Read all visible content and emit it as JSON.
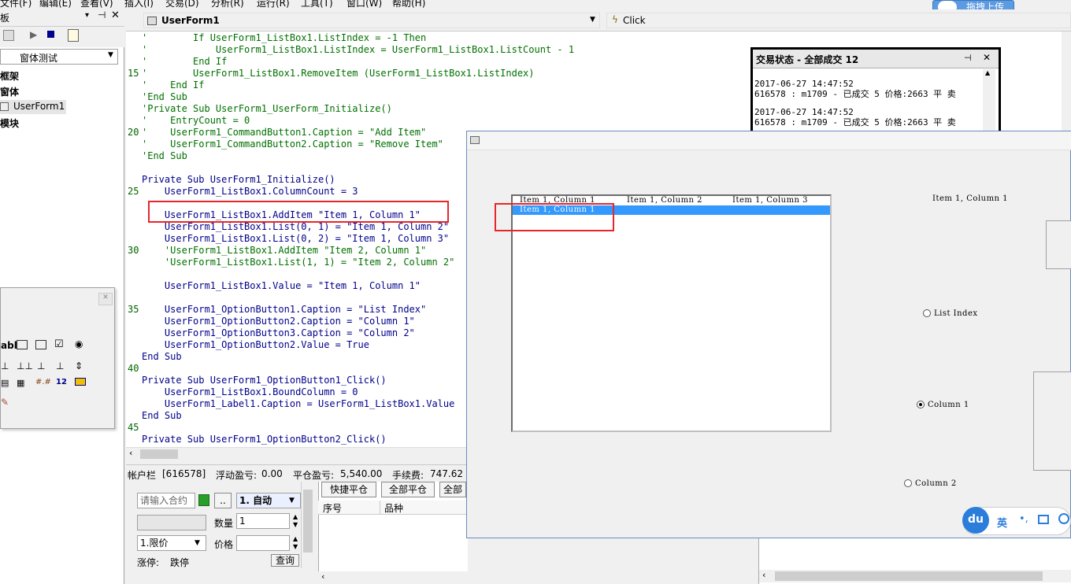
{
  "menubar": {
    "items": [
      "文件(F)",
      "编辑(E)",
      "查看(V)",
      "插入(I)",
      "交易(D)",
      "分析(R)",
      "运行(R)",
      "工具(T)",
      "窗口(W)",
      "帮助(H)"
    ],
    "upload_label": "拖拽上传"
  },
  "left_panel": {
    "title": "板",
    "combo_value": "窗体测试",
    "tree": [
      {
        "label": "框架"
      },
      {
        "label": "窗体"
      },
      {
        "label": "UserForm1"
      },
      {
        "label": "模块"
      }
    ]
  },
  "code_window": {
    "object_combo": "UserForm1",
    "procedure_combo": "Click",
    "line_numbers": [
      "15",
      "20",
      "25",
      "30",
      "35",
      "40",
      "45"
    ],
    "lines": [
      "'        If UserForm1_ListBox1.ListIndex = -1 Then",
      "'            UserForm1_ListBox1.ListIndex = UserForm1_ListBox1.ListCount - 1",
      "'        End If",
      "'        UserForm1_ListBox1.RemoveItem (UserForm1_ListBox1.ListIndex)",
      "'    End If",
      "'End Sub",
      "'Private Sub UserForm1_UserForm_Initialize()",
      "'    EntryCount = 0",
      "'    UserForm1_CommandButton1.Caption = \"Add Item\"",
      "'    UserForm1_CommandButton2.Caption = \"Remove Item\"",
      "'End Sub",
      "",
      "Private Sub UserForm1_Initialize()",
      "    UserForm1_ListBox1.ColumnCount = 3",
      "",
      "    UserForm1_ListBox1.AddItem \"Item 1, Column 1\"",
      "    UserForm1_ListBox1.List(0, 1) = \"Item 1, Column 2\"",
      "    UserForm1_ListBox1.List(0, 2) = \"Item 1, Column 3\"",
      "    'UserForm1_ListBox1.AddItem \"Item 2, Column 1\"",
      "    'UserForm1_ListBox1.List(1, 1) = \"Item 2, Column 2\"",
      "",
      "    UserForm1_ListBox1.Value = \"Item 1, Column 1\"",
      "",
      "    UserForm1_OptionButton1.Caption = \"List Index\"",
      "    UserForm1_OptionButton2.Caption = \"Column 1\"",
      "    UserForm1_OptionButton3.Caption = \"Column 2\"",
      "    UserForm1_OptionButton2.Value = True",
      "End Sub",
      "",
      "Private Sub UserForm1_OptionButton1_Click()",
      "    UserForm1_ListBox1.BoundColumn = 0",
      "    UserForm1_Label1.Caption = UserForm1_ListBox1.Value",
      "End Sub",
      "",
      "Private Sub UserForm1_OptionButton2_Click()"
    ]
  },
  "account_bar": {
    "label": "帐户栏",
    "account": "[616578]",
    "float_pl_label": "浮动盈亏:",
    "float_pl": "0.00",
    "close_pl_label": "平仓盈亏:",
    "close_pl": "5,540.00",
    "fee_label": "手续费:",
    "fee": "747.62"
  },
  "order_panel": {
    "contract_placeholder": "请输入合约",
    "dots_label": "..",
    "mode_value": "1. 自动",
    "qty_label": "数量",
    "qty_value": "1",
    "price_type": "1.限价",
    "price_label": "价格",
    "limit_label": "涨停:",
    "limit_down_label": "跌停",
    "query_button": "查询"
  },
  "grid_panel": {
    "buttons": [
      "快捷平仓",
      "全部平仓",
      "全部"
    ],
    "columns": [
      "序号",
      "品种"
    ]
  },
  "trade_status": {
    "title": "交易状态 - 全部成交 12",
    "entries": [
      {
        "time": "2017-06-27 14:47:52",
        "detail": "616578 : m1709 - 已成交 5 价格:2663 平 卖"
      },
      {
        "time": "2017-06-27 14:47:52",
        "detail": "616578 : m1709 - 已成交 5 价格:2663 平 卖"
      }
    ]
  },
  "userform": {
    "listbox_columns": [
      "Item 1, Column 1",
      "Item 1, Column 2",
      "Item 1, Column 3"
    ],
    "listbox_selected": "Item 1, Column 1",
    "label1_caption": "Item 1, Column 1",
    "options": [
      {
        "caption": "List Index",
        "checked": false
      },
      {
        "caption": "Column 1",
        "checked": true
      },
      {
        "caption": "Column 2",
        "checked": false
      }
    ]
  },
  "ime": {
    "logo": "du",
    "lang": "英"
  }
}
